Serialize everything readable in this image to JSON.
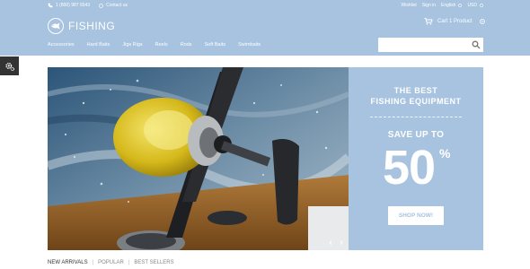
{
  "colors": {
    "brand": "#a7c3df",
    "settings": "#333333"
  },
  "topbar": {
    "phone": "1 (800) 987 6543",
    "contact": "Contact us",
    "account_links": [
      "Wishlist",
      "Sign in",
      "English",
      "USD"
    ]
  },
  "logo": {
    "text": "FISHING",
    "icon": "fish-icon"
  },
  "cart": {
    "label": "Cart 1 Product"
  },
  "nav": {
    "items": [
      "Accessories",
      "Hard Baits",
      "Jigs Rigs",
      "Reels",
      "Rods",
      "Soft Baits",
      "Swimbaits"
    ]
  },
  "search": {
    "value": "",
    "placeholder": ""
  },
  "promo": {
    "line1": "THE BEST",
    "line2": "FISHING EQUIPMENT",
    "save": "SAVE UP TO",
    "big": "50",
    "percent": "%",
    "cta": "SHOP NOW!"
  },
  "slider": {
    "prev": "‹",
    "next": "›"
  },
  "tabs": [
    "NEW ARRIVALS",
    "POPULAR",
    "BEST SELLERS"
  ]
}
